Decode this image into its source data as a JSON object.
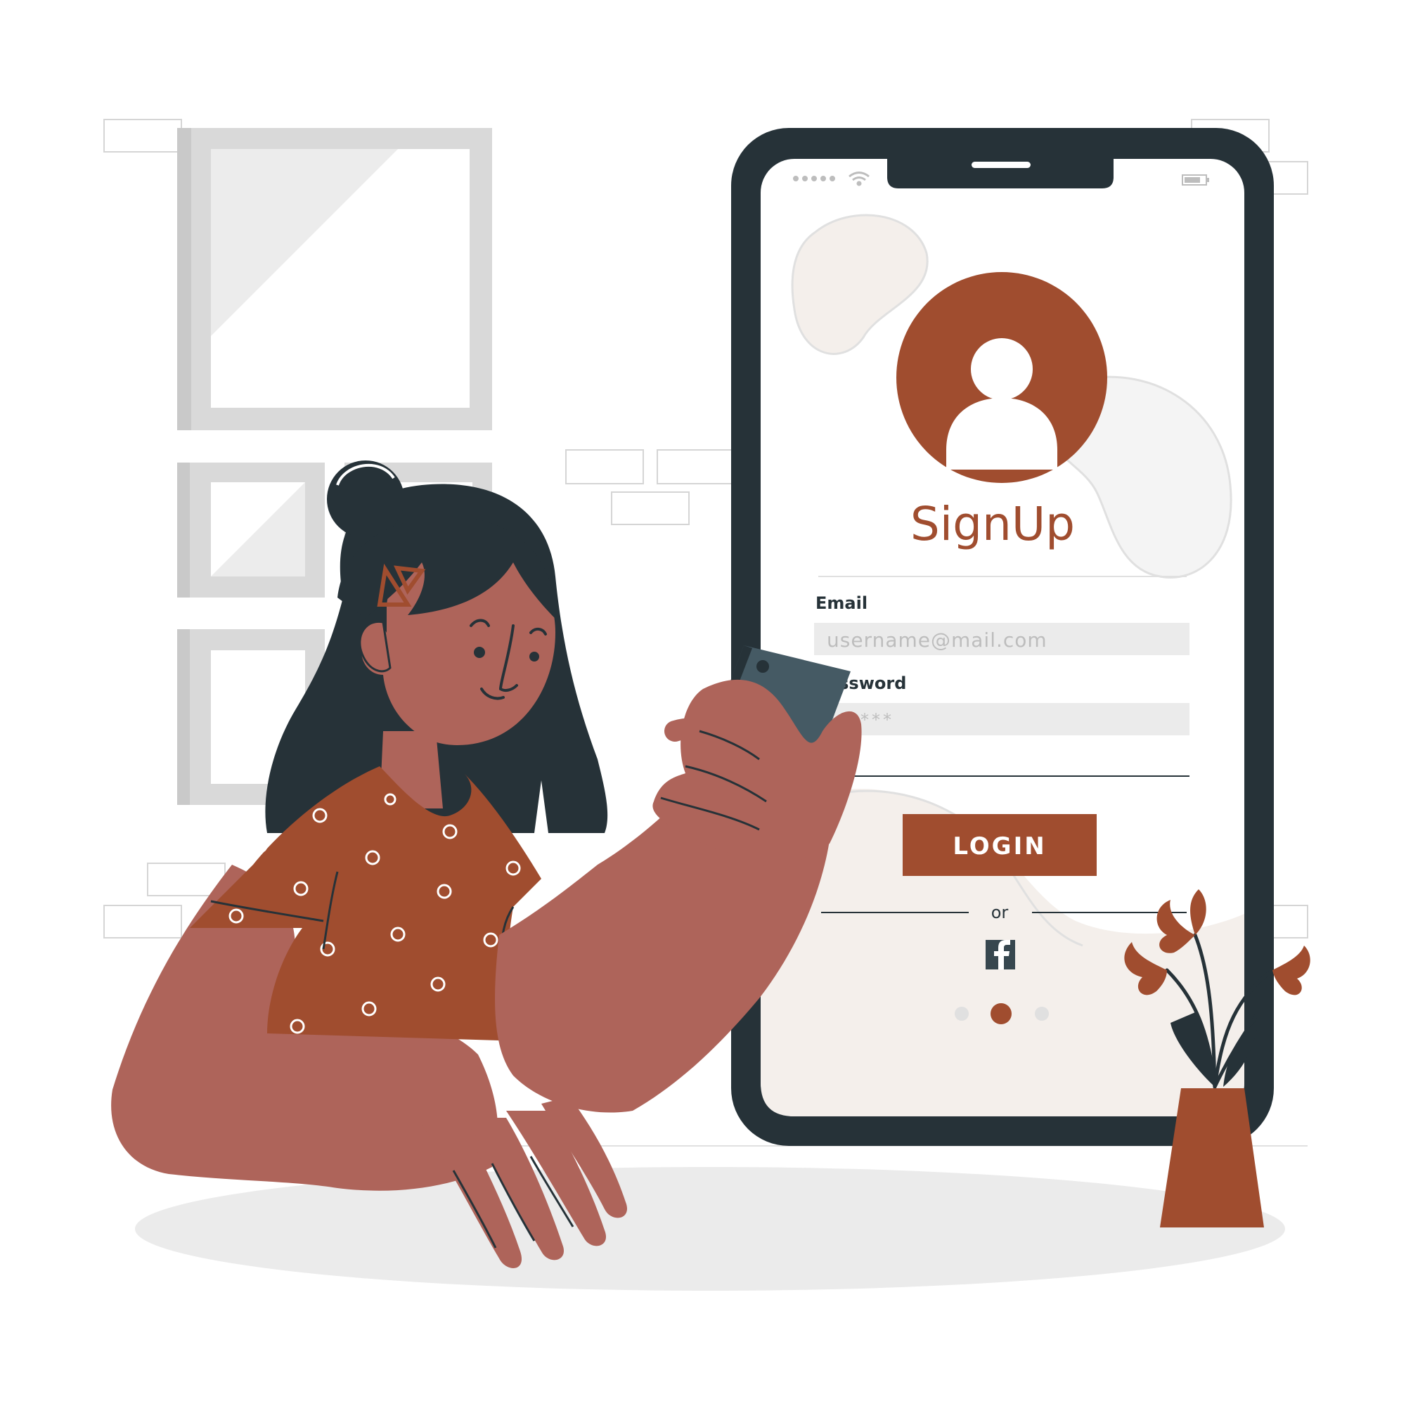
{
  "colors": {
    "accent": "#A04D2F",
    "skin": "#AE645A",
    "dark": "#263238",
    "frame_gray": "#D9D9D9",
    "input_bg": "#EBEBEB",
    "blob": "#F4EFEB"
  },
  "phone": {
    "status_bar": {
      "signal_icon": "signal-dots-icon",
      "wifi_icon": "wifi-icon",
      "battery_icon": "battery-icon"
    },
    "avatar_icon": "user-icon",
    "title": "SignUp",
    "email": {
      "label": "Email",
      "placeholder": "username@mail.com"
    },
    "password": {
      "label": "Password",
      "placeholder": "******"
    },
    "login_label": "LOGIN",
    "or_label": "or",
    "facebook_icon": "facebook-icon",
    "pagination": {
      "count": 3,
      "active_index": 1
    }
  }
}
